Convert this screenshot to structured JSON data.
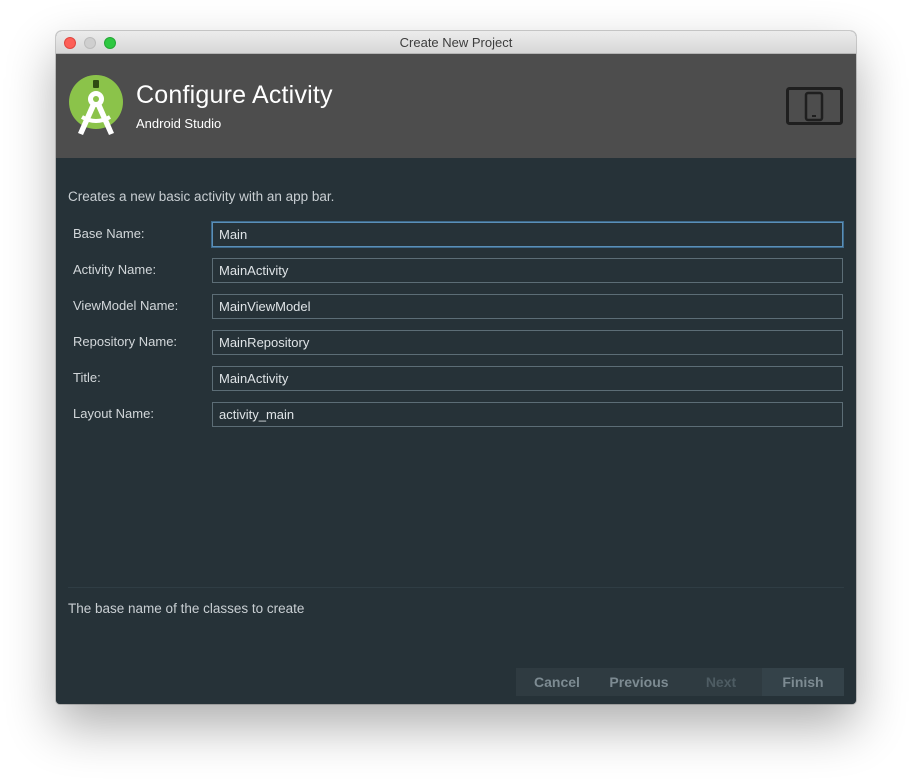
{
  "window": {
    "title": "Create New Project"
  },
  "header": {
    "title": "Configure Activity",
    "subtitle": "Android Studio",
    "logo_icon": "android-studio-logo-icon",
    "device_icon": "phone-tablet-icon",
    "background": "#4d4d4d"
  },
  "main": {
    "description": "Creates a new basic activity with an app bar.",
    "fields": [
      {
        "label": "Base Name:",
        "value": "Main",
        "focused": true
      },
      {
        "label": "Activity Name:",
        "value": "MainActivity"
      },
      {
        "label": "ViewModel Name:",
        "value": "MainViewModel"
      },
      {
        "label": "Repository Name:",
        "value": "MainRepository"
      },
      {
        "label": "Title:",
        "value": "MainActivity"
      },
      {
        "label": "Layout Name:",
        "value": "activity_main"
      }
    ],
    "hint": "The base name of the classes to create"
  },
  "buttons": {
    "cancel": "Cancel",
    "previous": "Previous",
    "next": "Next",
    "finish": "Finish"
  },
  "colors": {
    "content_background": "#263238",
    "focus_border": "#5a8fb8",
    "logo_green": "#8bc34a"
  }
}
